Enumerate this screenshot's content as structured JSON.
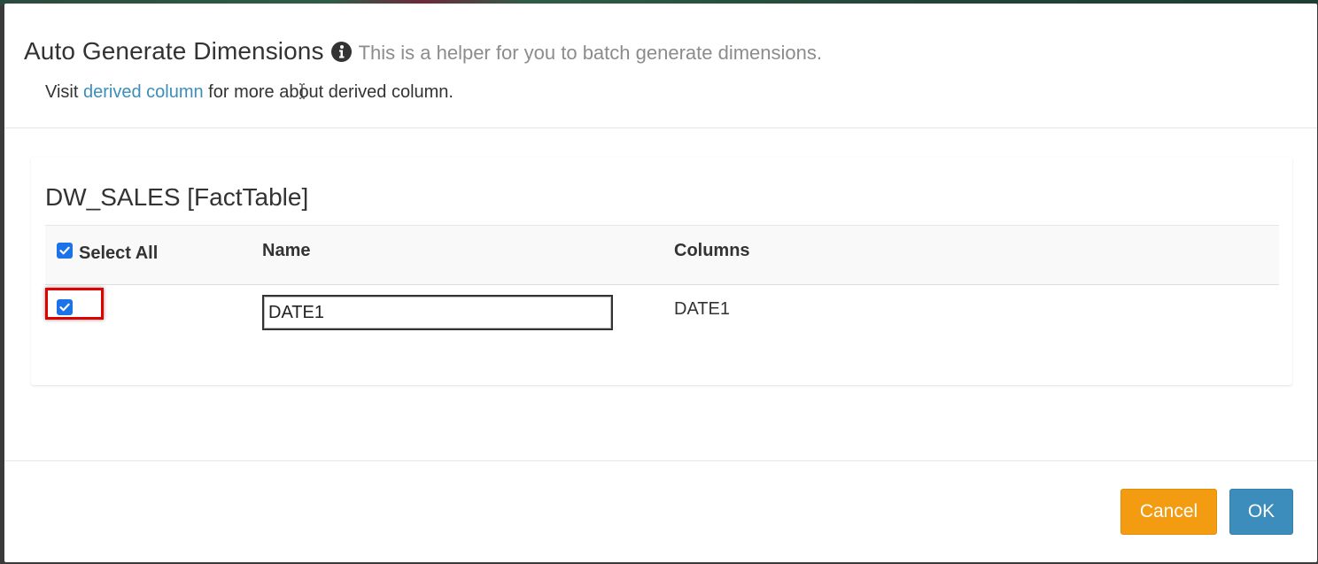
{
  "header": {
    "title": "Auto Generate Dimensions",
    "subtitle": "This is a helper for you to batch generate dimensions.",
    "visit_prefix": "Visit",
    "visit_link": "derived column",
    "visit_suffix": "for more about derived column."
  },
  "table": {
    "title": "DW_SALES [FactTable]",
    "select_all_label": "Select All",
    "select_all_checked": true,
    "columns": [
      "Name",
      "Columns"
    ],
    "rows": [
      {
        "checked": true,
        "name": "DATE1",
        "columns": "DATE1"
      }
    ]
  },
  "footer": {
    "cancel_label": "Cancel",
    "ok_label": "OK"
  },
  "colors": {
    "link": "#3c8dbc",
    "cancel": "#f39c12",
    "ok": "#3c8dbc",
    "highlight": "#e00000",
    "checkbox": "#1a73e8"
  },
  "icons": {
    "title_info": "info-circle-icon",
    "checkbox_check": "check-icon"
  }
}
